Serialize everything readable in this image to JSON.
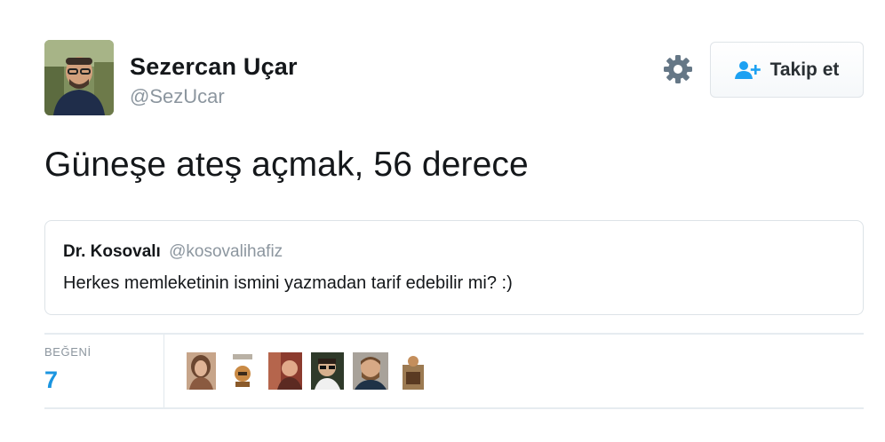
{
  "user": {
    "name": "Sezercan Uçar",
    "handle": "@SezUcar"
  },
  "actions": {
    "follow_label": "Takip et"
  },
  "tweet": {
    "text": "Güneşe ateş açmak, 56 derece"
  },
  "quoted": {
    "name": "Dr. Kosovalı",
    "handle": "@kosovalihafiz",
    "text": "Herkes memleketinin ismini yazmadan tarif edebilir mi? :)"
  },
  "stats": {
    "likes_label": "BEĞENİ",
    "likes_count": "7"
  },
  "icons": {
    "settings": "gear-icon",
    "follow": "person-add-icon"
  },
  "colors": {
    "accent": "#1b95e0",
    "muted": "#8c969f",
    "text": "#14171a"
  }
}
